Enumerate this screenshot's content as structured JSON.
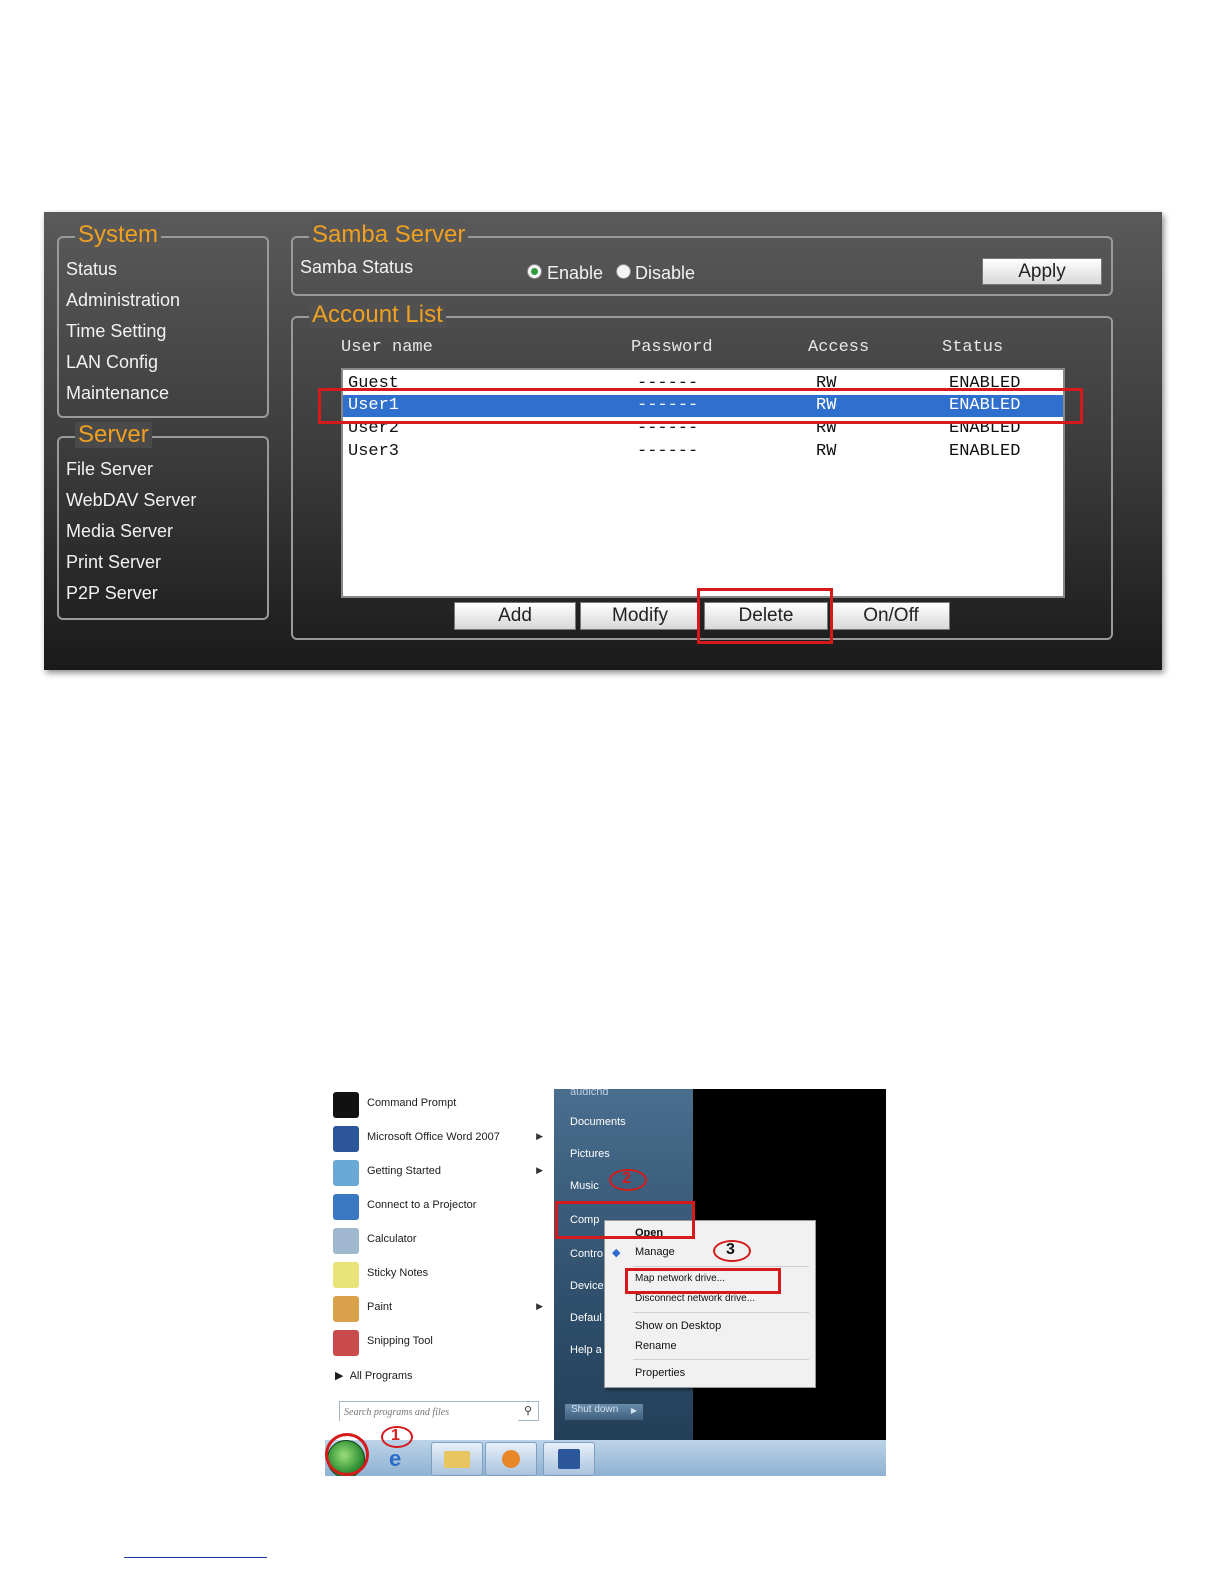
{
  "panel": {
    "system": {
      "legend": "System",
      "items": [
        "Status",
        "Administration",
        "Time Setting",
        "LAN Config",
        "Maintenance"
      ]
    },
    "server": {
      "legend": "Server",
      "items": [
        "File Server",
        "WebDAV Server",
        "Media Server",
        "Print Server",
        "P2P Server"
      ]
    },
    "samba": {
      "legend": "Samba Server",
      "status_label": "Samba Status",
      "enable_label": "Enable",
      "disable_label": "Disable",
      "selected": "Enable",
      "apply_label": "Apply"
    },
    "account_list": {
      "legend": "Account List",
      "columns": [
        "User name",
        "Password",
        "Access",
        "Status"
      ],
      "rows": [
        {
          "user": "Guest",
          "password": "------",
          "access": "RW",
          "status": "ENABLED"
        },
        {
          "user": "User1",
          "password": "------",
          "access": "RW",
          "status": "ENABLED"
        },
        {
          "user": "User2",
          "password": "------",
          "access": "RW",
          "status": "ENABLED"
        },
        {
          "user": "User3",
          "password": "------",
          "access": "RW",
          "status": "ENABLED"
        }
      ],
      "selected_row": "User1",
      "buttons": {
        "add": "Add",
        "modify": "Modify",
        "delete": "Delete",
        "onoff": "On/Off"
      }
    },
    "colors": {
      "legend": "#f0a020",
      "highlight": "#2f6fce",
      "callout": "#d41a1a"
    }
  },
  "startmenu": {
    "programs": [
      {
        "label": "Command Prompt",
        "icon": "command-prompt-icon",
        "arrow": false
      },
      {
        "label": "Microsoft Office Word 2007",
        "icon": "word-icon",
        "arrow": true
      },
      {
        "label": "Getting Started",
        "icon": "getting-started-icon",
        "arrow": true
      },
      {
        "label": "Connect to a Projector",
        "icon": "projector-icon",
        "arrow": false
      },
      {
        "label": "Calculator",
        "icon": "calculator-icon",
        "arrow": false
      },
      {
        "label": "Sticky Notes",
        "icon": "sticky-notes-icon",
        "arrow": false
      },
      {
        "label": "Paint",
        "icon": "paint-icon",
        "arrow": true
      },
      {
        "label": "Snipping Tool",
        "icon": "snipping-tool-icon",
        "arrow": false
      }
    ],
    "all_programs": "All Programs",
    "search_placeholder": "Search programs and files",
    "right_items": [
      "audichd",
      "Documents",
      "Pictures",
      "Music",
      "Comp",
      "Contro",
      "Device",
      "Defaul",
      "Help a"
    ],
    "shutdown_label": "Shut down",
    "context_menu": [
      "Open",
      "Manage",
      "Map network drive...",
      "Disconnect network drive...",
      "Show on Desktop",
      "Rename",
      "Properties"
    ],
    "step_labels": [
      "1",
      "2",
      "3"
    ]
  }
}
